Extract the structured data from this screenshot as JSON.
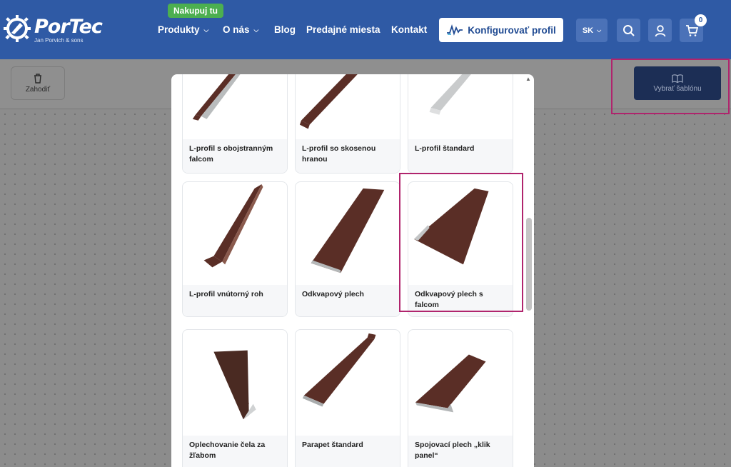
{
  "header": {
    "logo": {
      "name": "PorTec",
      "tagline": "Jan Porvich & sons"
    },
    "badge": "Nakupuj tu",
    "nav": [
      {
        "label": "Produkty",
        "dropdown": true
      },
      {
        "label": "O nás",
        "dropdown": true
      },
      {
        "label": "Blog",
        "dropdown": false
      },
      {
        "label": "Predajné miesta",
        "dropdown": false
      },
      {
        "label": "Kontakt",
        "dropdown": false
      }
    ],
    "configure_label": "Konfigurovať profil",
    "lang": "SK",
    "cart_count": "0",
    "icons": {
      "search": "search-icon",
      "user": "user-icon",
      "cart": "cart-icon"
    }
  },
  "toolbar": {
    "discard_label": "Zahodiť",
    "template_label": "Vybrať šablónu"
  },
  "modal": {
    "cards": [
      {
        "label": "L-profil s obojstranným falcom",
        "shape": "l-falc",
        "color": "#5a2e26"
      },
      {
        "label": "L-profil so skosenou hranou",
        "shape": "l-bevel",
        "color": "#5a2e26"
      },
      {
        "label": "L-profil štandard",
        "shape": "l-std",
        "color": "#c9cbcc"
      },
      {
        "label": "L-profil vnútorný roh",
        "shape": "l-inner",
        "color": "#5a2e26"
      },
      {
        "label": "Odkvapový plech",
        "shape": "drip",
        "color": "#5a2e26"
      },
      {
        "label": "Odkvapový plech s falcom",
        "shape": "drip-falc",
        "color": "#5a2e26"
      },
      {
        "label": "Oplechovanie čela za žľabom",
        "shape": "gutter",
        "color": "#4a2a22"
      },
      {
        "label": "Parapet štandard",
        "shape": "sill",
        "color": "#5a2e26"
      },
      {
        "label": "Spojovací plech „klik panel“",
        "shape": "connector",
        "color": "#5a2e26"
      }
    ]
  },
  "colors": {
    "header": "#2f5aa5",
    "highlight": "#b0246d",
    "badge": "#4caf50"
  }
}
